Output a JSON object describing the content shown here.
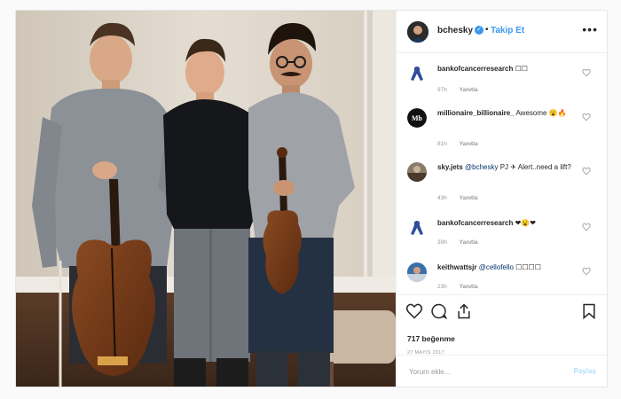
{
  "post": {
    "author": "bchesky",
    "separator": "•",
    "follow_label": "Takip Et",
    "more_label": "•••",
    "photo_alt": "Three men standing together, two holding a cello and a violin"
  },
  "comments": [
    {
      "user": "bankofcancerresearch",
      "text": " ☐☐",
      "mention": "",
      "time": "97h",
      "reply": "Yanıtla"
    },
    {
      "user": "millionaire_billionaire_",
      "text": " Awesome 😮🔥",
      "mention": "",
      "time": "81h",
      "reply": "Yanıtla"
    },
    {
      "user": "sky.jets",
      "text_before": " ",
      "mention": "@bchesky",
      "text": " PJ ✈ Alert..need a lift?",
      "time": "43h",
      "reply": "Yanıtla"
    },
    {
      "user": "bankofcancerresearch",
      "text": " ❤😮❤",
      "mention": "",
      "time": "39h",
      "reply": "Yanıtla"
    },
    {
      "user": "keithwattsjr",
      "text_before": " ",
      "mention": "@cellofello",
      "text": " ☐☐☐☐",
      "time": "23h",
      "reply": "Yanıtla"
    }
  ],
  "actions": {
    "likes": "717 beğenme",
    "date": "27 MAYIS 2017"
  },
  "add_comment": {
    "placeholder": "Yorum ekle...",
    "post_label": "Paylaş"
  },
  "colors": {
    "link_blue": "#3897f0",
    "mention_blue": "#003569",
    "muted": "#999999"
  }
}
